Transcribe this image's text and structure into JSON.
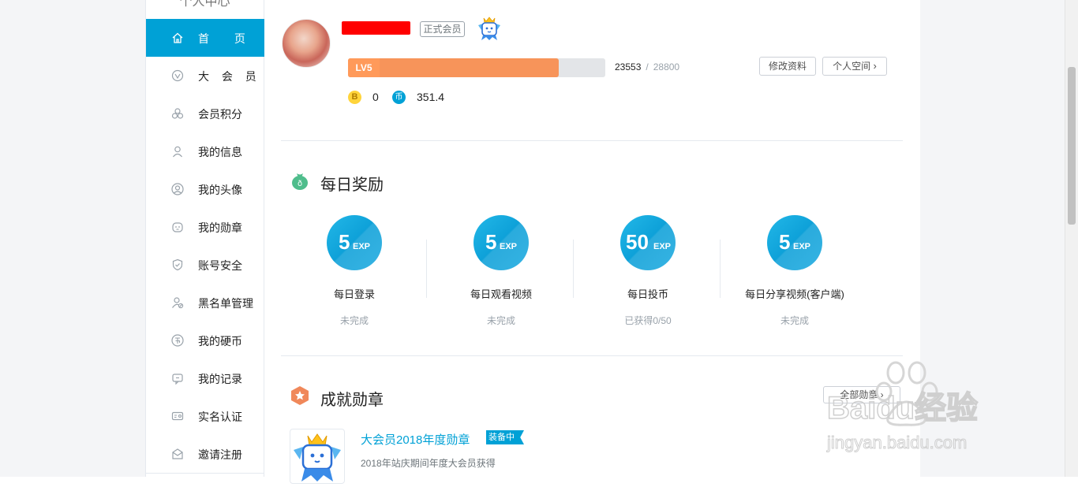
{
  "sidebar": {
    "title": "个人中心",
    "items": [
      {
        "label": "首 页",
        "icon": "home-icon",
        "active": true
      },
      {
        "label": "大 会 员",
        "icon": "vip-icon"
      },
      {
        "label": "会员积分",
        "icon": "points-icon"
      },
      {
        "label": "我的信息",
        "icon": "user-info-icon"
      },
      {
        "label": "我的头像",
        "icon": "avatar-icon"
      },
      {
        "label": "我的勋章",
        "icon": "medal-icon"
      },
      {
        "label": "账号安全",
        "icon": "shield-icon"
      },
      {
        "label": "黑名单管理",
        "icon": "blacklist-icon"
      },
      {
        "label": "我的硬币",
        "icon": "coin-icon"
      },
      {
        "label": "我的记录",
        "icon": "record-icon"
      },
      {
        "label": "实名认证",
        "icon": "id-card-icon"
      },
      {
        "label": "邀请注册",
        "icon": "invite-icon"
      }
    ]
  },
  "profile": {
    "member_type": "正式会员",
    "level_label": "LV5",
    "exp_current": "23553",
    "exp_separator": "/",
    "exp_next": "28800",
    "exp_fraction": 0.818,
    "edit_button": "修改资料",
    "space_button": "个人空间",
    "b_coin_symbol": "B",
    "b_coin_value": "0",
    "hard_coin_symbol": "币",
    "hard_coin_value": "351.4"
  },
  "daily": {
    "title": "每日奖励",
    "exp_unit": "EXP",
    "tasks": [
      {
        "value": "5",
        "name": "每日登录",
        "status": "未完成"
      },
      {
        "value": "5",
        "name": "每日观看视频",
        "status": "未完成"
      },
      {
        "value": "50",
        "name": "每日投币",
        "status": "已获得0/50"
      },
      {
        "value": "5",
        "name": "每日分享视频(客户端)",
        "status": "未完成"
      }
    ]
  },
  "achievements": {
    "title": "成就勋章",
    "all_button": "全部勋章",
    "badge": {
      "name": "大会员2018年度勋章",
      "tag": "装备中",
      "desc": "2018年站庆期间年度大会员获得"
    }
  },
  "watermark": {
    "brand": "Baidu经验",
    "url": "jingyan.baidu.com"
  },
  "colors": {
    "accent": "#00a1d6",
    "level_fill": "#f7945a",
    "level_badge": "#ff9a5a",
    "b_coin": "#ffd43b",
    "daily_icon": "#4fbd8c",
    "achievement_icon": "#f0885a"
  }
}
